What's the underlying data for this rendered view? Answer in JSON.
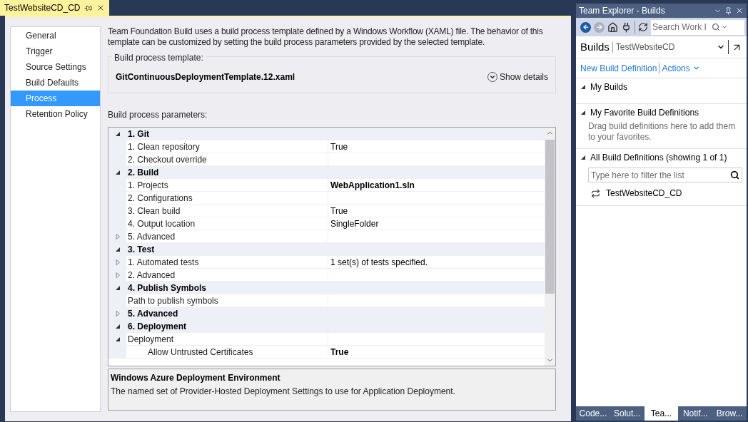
{
  "document_tab": {
    "title": "TestWebsiteCD_CD",
    "selected": true
  },
  "nav": [
    {
      "label": "General",
      "selected": false
    },
    {
      "label": "Trigger",
      "selected": false
    },
    {
      "label": "Source Settings",
      "selected": false
    },
    {
      "label": "Build Defaults",
      "selected": false
    },
    {
      "label": "Process",
      "selected": true
    },
    {
      "label": "Retention Policy",
      "selected": false
    }
  ],
  "description": "Team Foundation Build uses a build process template defined by a Windows Workflow (XAML) file. The behavior of this template can be customized by setting the build process parameters provided by the selected template.",
  "template": {
    "legend": "Build process template:",
    "name": "GitContinuousDeploymentTemplate.12.xaml",
    "details_button": "Show details"
  },
  "parameters_label": "Build process parameters:",
  "parameters": [
    {
      "kind": "category",
      "name": "1. Git",
      "expanded": true,
      "children": [
        {
          "kind": "param",
          "name": "1. Clean repository",
          "value": "True"
        },
        {
          "kind": "param",
          "name": "2. Checkout override"
        }
      ]
    },
    {
      "kind": "category",
      "name": "2. Build",
      "expanded": true,
      "children": [
        {
          "kind": "param",
          "name": "1. Projects",
          "value": "WebApplication1.sln",
          "modified": true
        },
        {
          "kind": "param",
          "name": "2. Configurations"
        },
        {
          "kind": "param",
          "name": "3. Clean build",
          "value": "True"
        },
        {
          "kind": "param",
          "name": "4. Output location",
          "value": "SingleFolder"
        },
        {
          "kind": "param",
          "name": "5. Advanced",
          "expanded": false
        }
      ]
    },
    {
      "kind": "category",
      "name": "3. Test",
      "expanded": true,
      "children": [
        {
          "kind": "param",
          "name": "1. Automated tests",
          "value": "1 set(s) of tests specified.",
          "expanded": false
        },
        {
          "kind": "param",
          "name": "2. Advanced",
          "expanded": false
        }
      ]
    },
    {
      "kind": "category",
      "name": "4. Publish Symbols",
      "expanded": true,
      "children": [
        {
          "kind": "param",
          "name": "Path to publish symbols"
        }
      ]
    },
    {
      "kind": "category",
      "name": "5. Advanced",
      "expanded": false
    },
    {
      "kind": "category",
      "name": "6. Deployment",
      "expanded": true,
      "children": [
        {
          "kind": "param",
          "name": "Deployment",
          "expanded": true,
          "children": [
            {
              "kind": "param",
              "name": "Allow Untrusted Certificates",
              "value": "True",
              "modified": true
            }
          ]
        }
      ]
    }
  ],
  "help": {
    "title": "Windows Azure Deployment Environment",
    "text": "The named set of Provider-Hosted Deployment Settings to use for Application Deployment."
  },
  "team_explorer": {
    "title": "Team Explorer - Builds",
    "search_placeholder": "Search Work I",
    "page": "Builds",
    "project": "TestWebsiteCD",
    "links": [
      "New Build Definition",
      "Actions"
    ],
    "sections": [
      {
        "kind": "empty",
        "title": "My Builds",
        "expanded": true
      },
      {
        "kind": "hint",
        "title": "My Favorite Build Definitions",
        "expanded": true,
        "text": "Drag build definitions here to add them to your favorites."
      },
      {
        "kind": "list",
        "title": "All Build Definitions (showing 1 of 1)",
        "expanded": true,
        "filter_placeholder": "Type here to filter the list",
        "items": [
          "TestWebsiteCD_CD"
        ]
      }
    ],
    "tabs": [
      {
        "label": "Code...",
        "selected": false
      },
      {
        "label": "Solut...",
        "selected": false
      },
      {
        "label": "Tea...",
        "selected": true
      },
      {
        "label": "Notif...",
        "selected": false
      },
      {
        "label": "Brow...",
        "selected": false
      }
    ]
  }
}
